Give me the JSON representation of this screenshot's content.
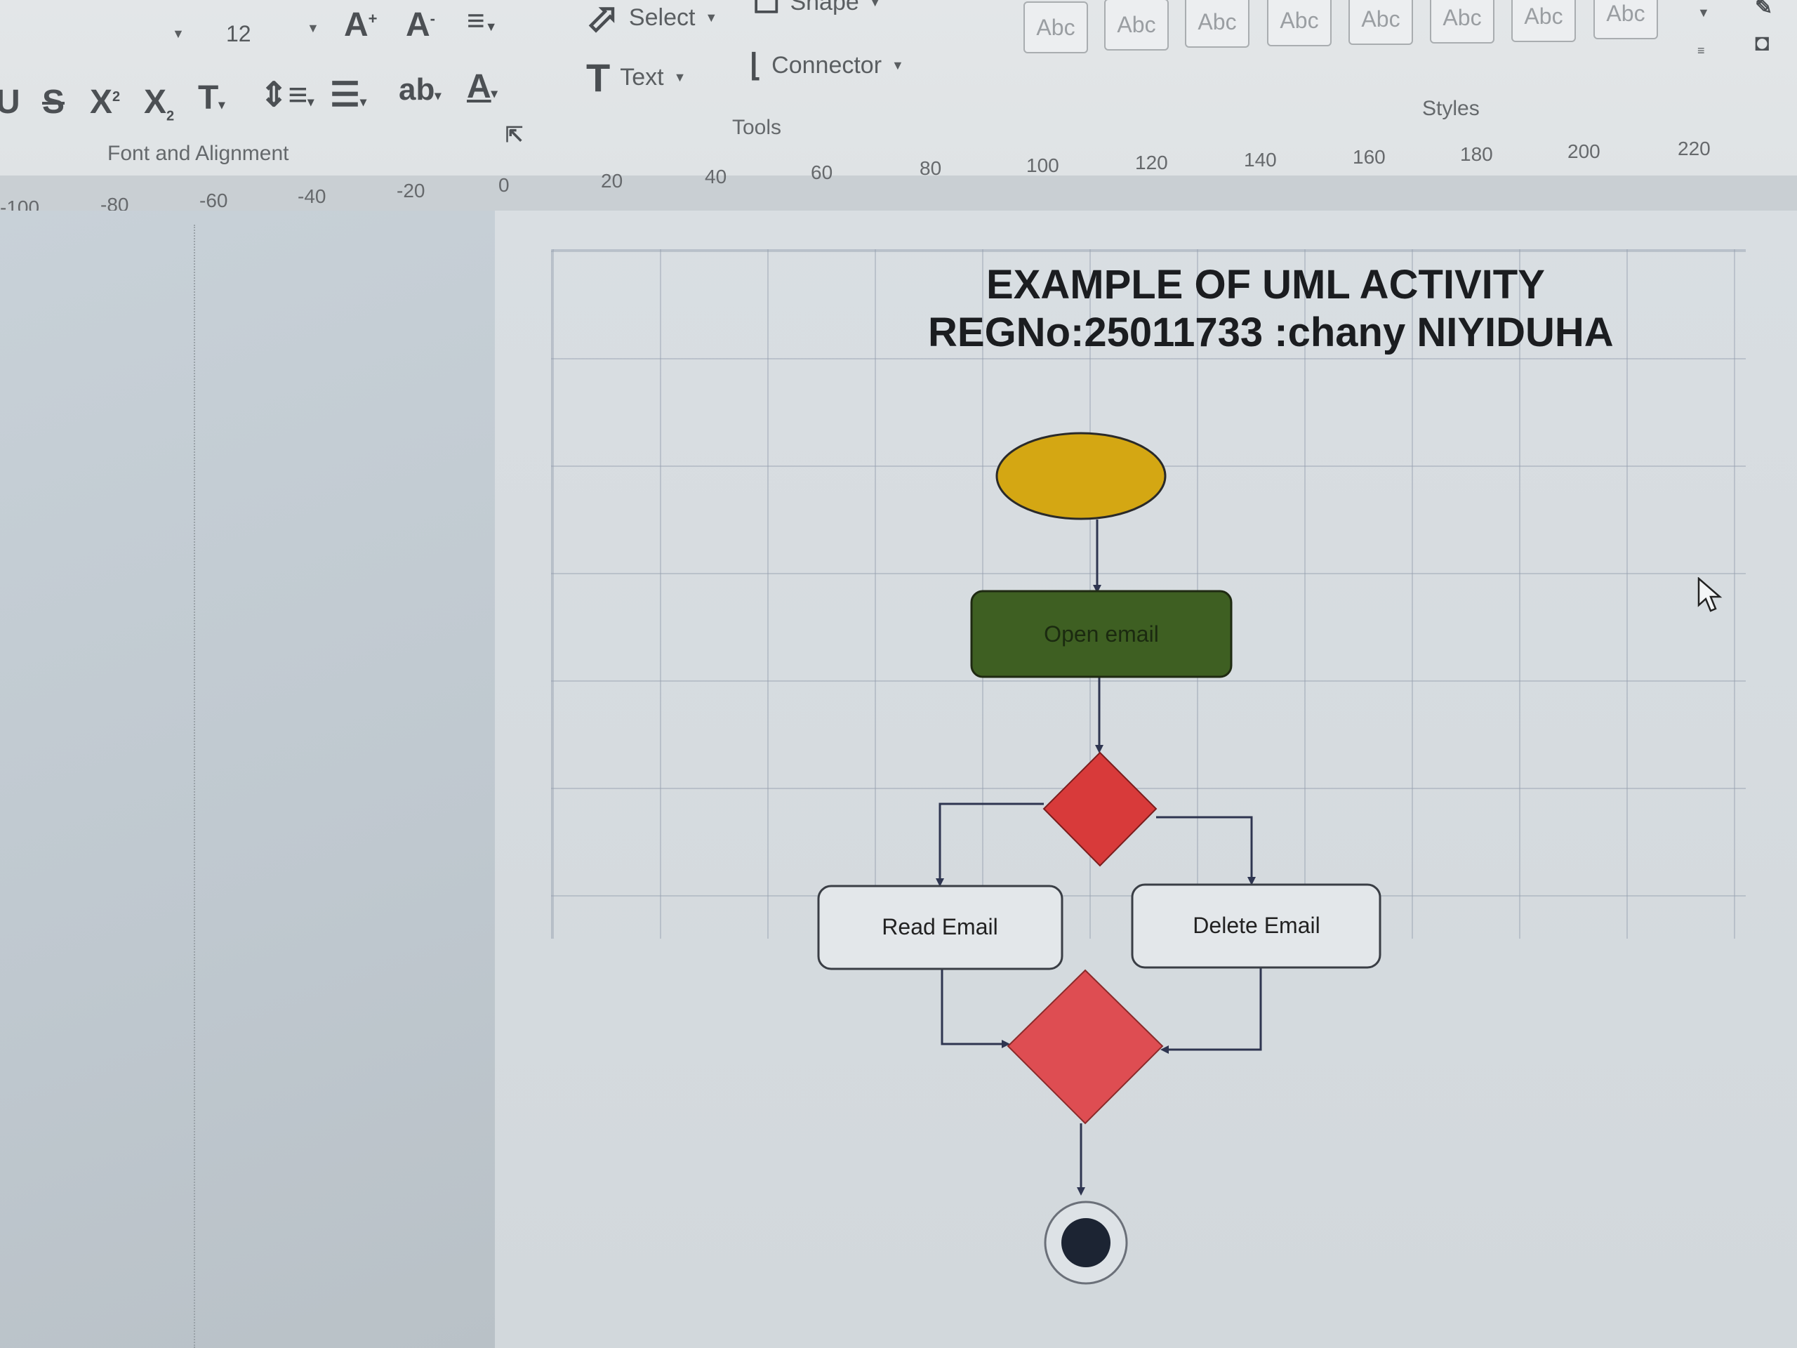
{
  "ribbon": {
    "font_size_value": "12",
    "font_group_label": "Font and Alignment",
    "tools": {
      "select_label": "Select",
      "shape_label": "Shape",
      "text_label": "Text",
      "connector_label": "Connector",
      "group_label": "Tools"
    },
    "styles": {
      "swatches": [
        "Abc",
        "Abc",
        "Abc",
        "Abc",
        "Abc",
        "Abc",
        "Abc",
        "Abc"
      ],
      "group_label": "Styles"
    }
  },
  "ruler": {
    "ticks": [
      "-100",
      "-80",
      "-60",
      "-40",
      "-20",
      "0",
      "20",
      "40",
      "60",
      "80",
      "100",
      "120",
      "140",
      "160",
      "180",
      "200",
      "220"
    ]
  },
  "diagram": {
    "title_line1": "EXAMPLE OF UML ACTIVITY",
    "title_line2": "REGNo:25011733 :chany NIYIDUHA",
    "nodes": {
      "open_email": "Open email",
      "read_email": "Read Email",
      "delete_email": "Delete Email"
    },
    "colors": {
      "start_node": "#d4a713",
      "action_open": "#3e5f22",
      "decision": "#d83a3a",
      "merge": "#de4d52",
      "end_node": "#1c2433"
    }
  }
}
